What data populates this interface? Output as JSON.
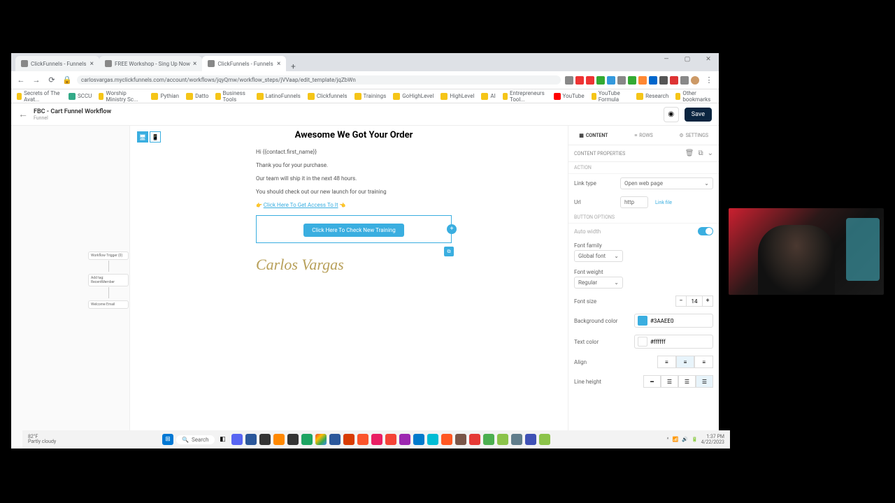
{
  "browser": {
    "tabs": [
      {
        "label": "ClickFunnels - Funnels",
        "active": false
      },
      {
        "label": "FREE Workshop - Sing Up Now",
        "active": false
      },
      {
        "label": "ClickFunnels - Funnels",
        "active": true
      }
    ],
    "url": "carlosvargas.myclickfunnels.com/account/workflows/jqyQmw/workflow_steps/jVVaap/edit_template/jqZbWn",
    "bookmarks": [
      "Secrets of The Avat...",
      "SCCU",
      "Worship Ministry Sc...",
      "Pythian",
      "Datto",
      "Business Tools",
      "LatinoFunnels",
      "Clickfunnels",
      "Trainings",
      "GoHighLevel",
      "HighLevel",
      "AI",
      "Entrepreneurs Tool...",
      "YouTube",
      "YouTube Formula",
      "Research"
    ],
    "other_bookmarks": "Other bookmarks"
  },
  "workflow": {
    "back": "←",
    "title": "FBC - Cart Funnel Workflow",
    "subtitle": "Funnel",
    "preview_icon": "◉",
    "save": "Save"
  },
  "steps": [
    "Workflow Trigger (0)",
    "Add tag: RecentMember",
    "Welcome Email"
  ],
  "email": {
    "title": "Awesome We Got Your Order",
    "line1": "Hi {{contact.first_name}}",
    "line2": "Thank you for your purchase.",
    "line3": "Our team will ship it in the next 48 hours.",
    "line4": "You should check out our new launch for our training",
    "pointer": "👉",
    "link": "Click Here To Get Access To It",
    "pointer2": "👈",
    "cta": "Click Here To Check New Training",
    "signature": "Carlos Vargas"
  },
  "panel": {
    "tabs": {
      "content": "CONTENT",
      "rows": "ROWS",
      "settings": "SETTINGS"
    },
    "header": "CONTENT PROPERTIES",
    "section_action": "ACTION",
    "link_type_label": "Link type",
    "link_type_value": "Open web page",
    "url_label": "Url",
    "url_value": "http",
    "link_file": "Link file",
    "section_button": "BUTTON OPTIONS",
    "auto_width": "Auto width",
    "font_family_label": "Font family",
    "font_family_value": "Global font",
    "font_weight_label": "Font weight",
    "font_weight_value": "Regular",
    "font_size_label": "Font size",
    "font_size_value": "14",
    "bg_label": "Background color",
    "bg_value": "#3AAEE0",
    "text_label": "Text color",
    "text_value": "#ffffff",
    "align_label": "Align",
    "lh_label": "Line height"
  },
  "taskbar": {
    "temp": "82°F",
    "weather": "Partly cloudy",
    "search": "Search",
    "time": "1:37 PM",
    "date": "4/22/2023"
  }
}
